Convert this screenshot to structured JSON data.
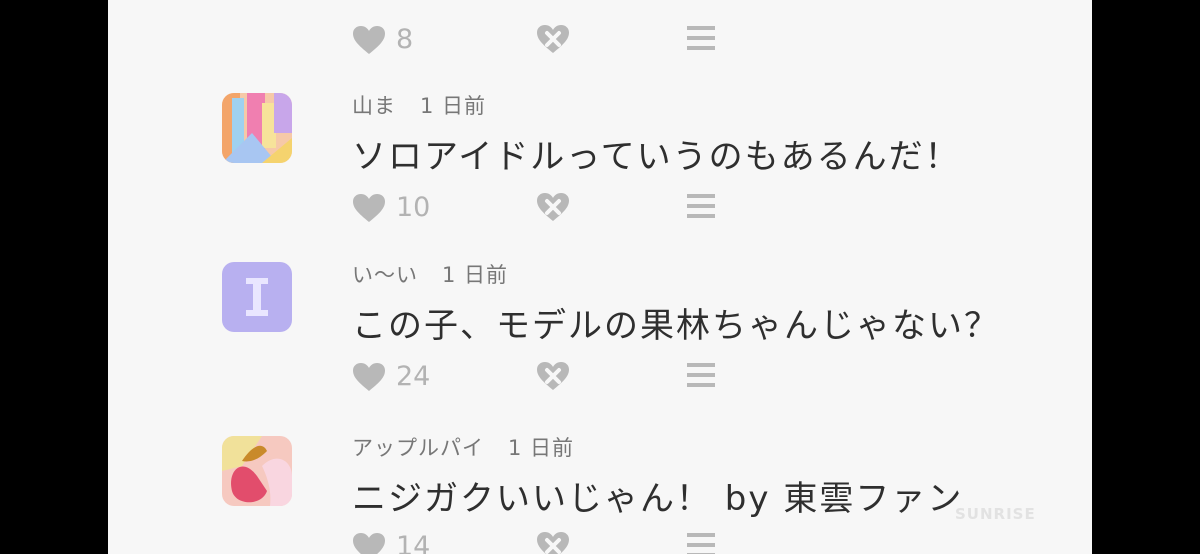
{
  "top_row": {
    "likes": "8"
  },
  "comments": [
    {
      "user": "山ま",
      "time": "1 日前",
      "text": "ソロアイドルっていうのもあるんだ！",
      "likes": "10"
    },
    {
      "user": "い〜い",
      "time": "1 日前",
      "text": "この子、モデルの果林ちゃんじゃない？",
      "likes": "24",
      "avatar_letter": "I"
    },
    {
      "user": "アップルパイ",
      "time": "1 日前",
      "text": "ニジガクいいじゃん！ by 東雲ファン",
      "likes": "14"
    }
  ],
  "watermark": "SUNRISE",
  "icons": {
    "like": "heart-icon",
    "dislike": "broken-heart-icon",
    "menu": "menu-icon"
  },
  "colors": {
    "background": "#f7f7f7",
    "icon": "#b8b8b8",
    "text": "#2f2f2f",
    "meta": "#777777",
    "avatar2": "#b8b0f0"
  }
}
